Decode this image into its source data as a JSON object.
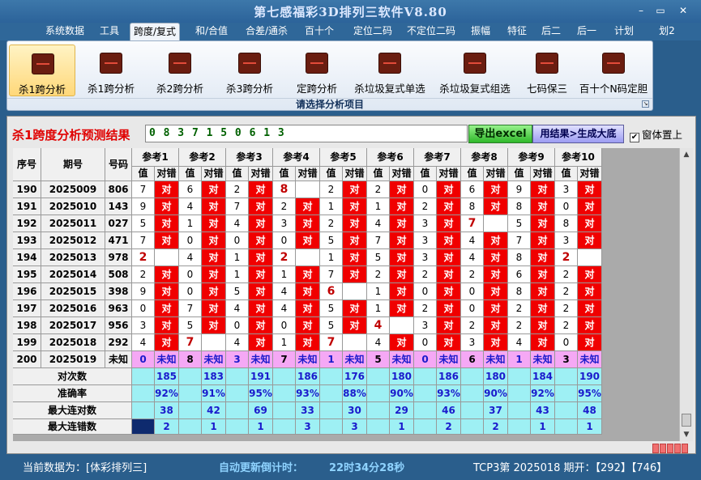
{
  "window": {
    "title": "第七感福彩3D排列三软件V8.80",
    "minimize_label": "–",
    "restore_label": "▭",
    "close_label": "✕"
  },
  "menu": [
    "系统数据",
    "工具",
    "跨度/复式",
    "和/合值",
    "合差/通杀",
    "百十个",
    "定位二码",
    "不定位二码",
    "振幅",
    "特征",
    "后二",
    "后一",
    "计划",
    "划2"
  ],
  "menu_active": 2,
  "ribbon": {
    "buttons": [
      "杀1跨分析",
      "杀1跨分析",
      "杀2跨分析",
      "杀3跨分析",
      "定跨分析",
      "杀垃圾复式单选",
      "杀垃圾复式组选",
      "七码保三",
      "百十个N码定胆"
    ],
    "selected": 0,
    "footer": "请选择分析项目",
    "icon": "chart-icon"
  },
  "result": {
    "title": "杀1跨度分析预测结果",
    "value": "0 8 3 7 1 5 0 6 1 3",
    "excel_label": "导出excel",
    "gen_label": "用结果>生成大底",
    "topmost_label": "窗体置上",
    "topmost_checked": true
  },
  "table": {
    "headers": {
      "seq": "序号",
      "issue": "期号",
      "code": "号码",
      "value": "值",
      "check": "对错"
    },
    "refs": [
      "参考1",
      "参考2",
      "参考3",
      "参考4",
      "参考5",
      "参考6",
      "参考7",
      "参考8",
      "参考9",
      "参考10"
    ],
    "dui": "对",
    "rows": [
      {
        "seq": "190",
        "issue": "2025009",
        "code": "806",
        "v": [
          "7",
          "6",
          "2",
          "8",
          "2",
          "2",
          "0",
          "6",
          "9",
          "3"
        ],
        "c": [
          1,
          1,
          1,
          0,
          1,
          1,
          1,
          1,
          1,
          1
        ]
      },
      {
        "seq": "191",
        "issue": "2025010",
        "code": "143",
        "v": [
          "9",
          "4",
          "7",
          "2",
          "1",
          "1",
          "2",
          "8",
          "8",
          "0"
        ],
        "c": [
          1,
          1,
          1,
          1,
          1,
          1,
          1,
          1,
          1,
          1
        ]
      },
      {
        "seq": "192",
        "issue": "2025011",
        "code": "027",
        "v": [
          "5",
          "1",
          "4",
          "3",
          "2",
          "4",
          "3",
          "7",
          "5",
          "8"
        ],
        "c": [
          1,
          1,
          1,
          1,
          1,
          1,
          1,
          0,
          1,
          1
        ]
      },
      {
        "seq": "193",
        "issue": "2025012",
        "code": "471",
        "v": [
          "7",
          "0",
          "0",
          "0",
          "5",
          "7",
          "3",
          "4",
          "7",
          "3"
        ],
        "c": [
          1,
          1,
          1,
          1,
          1,
          1,
          1,
          1,
          1,
          1
        ]
      },
      {
        "seq": "194",
        "issue": "2025013",
        "code": "978",
        "v": [
          "2",
          "4",
          "1",
          "2",
          "1",
          "5",
          "3",
          "4",
          "8",
          "2"
        ],
        "c": [
          0,
          1,
          1,
          0,
          1,
          1,
          1,
          1,
          1,
          0
        ]
      },
      {
        "seq": "195",
        "issue": "2025014",
        "code": "508",
        "v": [
          "2",
          "0",
          "1",
          "1",
          "7",
          "2",
          "2",
          "2",
          "6",
          "2"
        ],
        "c": [
          1,
          1,
          1,
          1,
          1,
          1,
          1,
          1,
          1,
          1
        ]
      },
      {
        "seq": "196",
        "issue": "2025015",
        "code": "398",
        "v": [
          "9",
          "0",
          "5",
          "4",
          "6",
          "1",
          "0",
          "0",
          "8",
          "2"
        ],
        "c": [
          1,
          1,
          1,
          1,
          0,
          1,
          1,
          1,
          1,
          1
        ]
      },
      {
        "seq": "197",
        "issue": "2025016",
        "code": "963",
        "v": [
          "0",
          "7",
          "4",
          "4",
          "5",
          "1",
          "2",
          "0",
          "2",
          "2"
        ],
        "c": [
          1,
          1,
          1,
          1,
          1,
          1,
          1,
          1,
          1,
          1
        ]
      },
      {
        "seq": "198",
        "issue": "2025017",
        "code": "956",
        "v": [
          "3",
          "5",
          "0",
          "0",
          "5",
          "4",
          "3",
          "2",
          "2",
          "2"
        ],
        "c": [
          1,
          1,
          1,
          1,
          1,
          0,
          1,
          1,
          1,
          1
        ]
      },
      {
        "seq": "199",
        "issue": "2025018",
        "code": "292",
        "v": [
          "4",
          "7",
          "4",
          "1",
          "7",
          "4",
          "0",
          "3",
          "4",
          "0"
        ],
        "c": [
          1,
          0,
          1,
          1,
          0,
          1,
          1,
          1,
          1,
          1
        ]
      }
    ],
    "future": {
      "seq": "200",
      "issue": "2025019",
      "code": "未知",
      "v": [
        "0",
        "8",
        "3",
        "7",
        "1",
        "5",
        "0",
        "6",
        "1",
        "3"
      ],
      "label": "未知",
      "stats_cells": [
        1,
        0,
        0,
        0,
        0,
        1,
        0,
        0,
        0,
        0
      ]
    },
    "stats": [
      {
        "label": "对次数",
        "values": [
          "185",
          "183",
          "191",
          "186",
          "176",
          "180",
          "186",
          "180",
          "184",
          "190"
        ]
      },
      {
        "label": "准确率",
        "values": [
          "92%",
          "91%",
          "95%",
          "93%",
          "88%",
          "90%",
          "93%",
          "90%",
          "92%",
          "95%"
        ]
      },
      {
        "label": "最大连对数",
        "values": [
          "38",
          "42",
          "69",
          "33",
          "30",
          "29",
          "46",
          "37",
          "43",
          "48"
        ]
      },
      {
        "label": "最大连错数",
        "values": [
          "2",
          "1",
          "1",
          "3",
          "3",
          "1",
          "2",
          "2",
          "1",
          "1"
        ]
      }
    ]
  },
  "status": {
    "current": "当前数据为：[体彩排列三]",
    "countdown_label": "自动更新倒计时：",
    "countdown": "22时34分28秒",
    "draw": "TCP3第 2025018 期开：【292】【746】"
  }
}
